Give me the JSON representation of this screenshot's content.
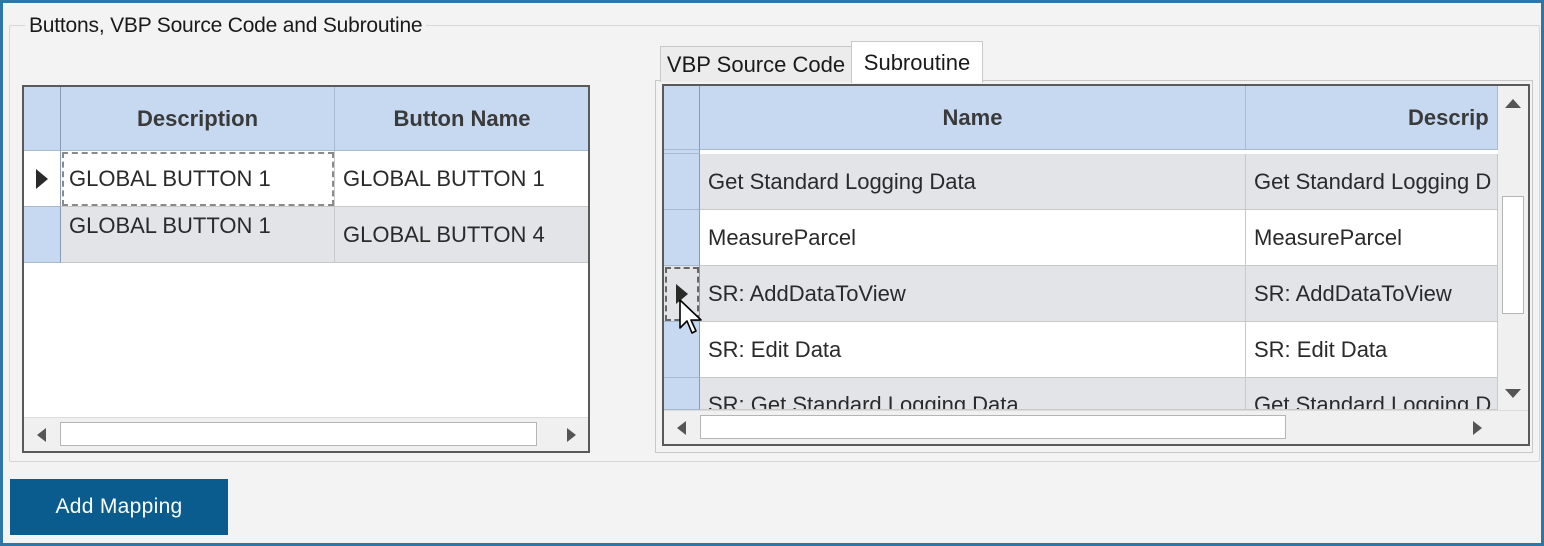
{
  "group": {
    "title": "Buttons, VBP Source Code and Subroutine"
  },
  "left_grid": {
    "columns": [
      "Description",
      "Button Name"
    ],
    "rows": [
      {
        "description": "GLOBAL BUTTON 1",
        "button_name": "GLOBAL BUTTON 1"
      },
      {
        "description": "GLOBAL BUTTON 1",
        "button_name": "GLOBAL BUTTON 4"
      }
    ]
  },
  "tabs": [
    {
      "label": "VBP Source Code",
      "active": false
    },
    {
      "label": "Subroutine",
      "active": true
    }
  ],
  "right_grid": {
    "columns": [
      "Name",
      "Descrip"
    ],
    "rows": [
      {
        "name": "Get Standard Logging Data",
        "description": "Get Standard Logging D"
      },
      {
        "name": "MeasureParcel",
        "description": "MeasureParcel"
      },
      {
        "name": "SR: AddDataToView",
        "description": "SR: AddDataToView"
      },
      {
        "name": "SR: Edit Data",
        "description": "SR: Edit Data"
      },
      {
        "name": "SR: Get Standard Logging Data",
        "description": "Get Standard Logging D"
      }
    ]
  },
  "actions": {
    "add_mapping": "Add Mapping"
  },
  "colors": {
    "frame_border": "#2e76a7",
    "header_bg": "#c6d9f1",
    "alt_row_bg": "#e2e4e8",
    "button_bg": "#0b5c8e"
  }
}
